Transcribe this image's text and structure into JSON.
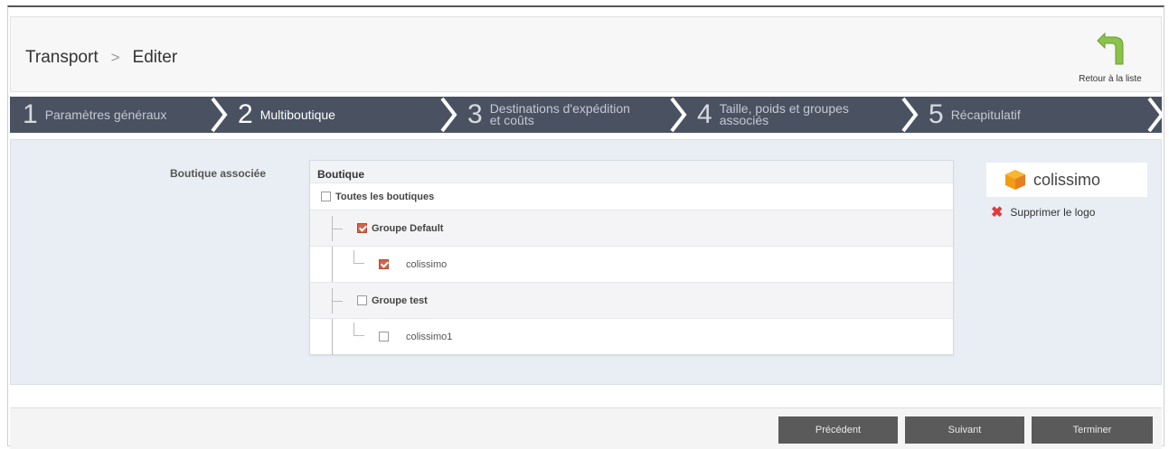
{
  "header": {
    "breadcrumb": [
      "Transport",
      "Editer"
    ],
    "separator": ">",
    "back_label": "Retour à la liste"
  },
  "steps": [
    {
      "num": "1",
      "label": "Paramètres généraux",
      "active": false
    },
    {
      "num": "2",
      "label": "Multiboutique",
      "active": true
    },
    {
      "num": "3",
      "label": "Destinations d'expédition et coûts",
      "active": false
    },
    {
      "num": "4",
      "label": "Taille, poids et groupes associés",
      "active": false
    },
    {
      "num": "5",
      "label": "Récapitulatif",
      "active": false
    }
  ],
  "form": {
    "shop_label": "Boutique associée",
    "tree_header": "Boutique",
    "all_shops": "Toutes les boutiques",
    "group_default": "Groupe Default",
    "shop_default": "colissimo",
    "group_test": "Groupe test",
    "shop_test": "colissimo1",
    "checked": {
      "all": false,
      "group_default": true,
      "shop_default": true,
      "group_test": false,
      "shop_test": false
    }
  },
  "logo": {
    "text": "colissimo",
    "delete_label": "Supprimer le logo",
    "brand_color": "#f39c12"
  },
  "footer": {
    "prev": "Précédent",
    "next": "Suivant",
    "finish": "Terminer"
  },
  "colors": {
    "steps_bg": "#4a5262",
    "panel_bg": "#e9edf4",
    "check_color": "#d0644a",
    "back_arrow": "#8bc34a"
  }
}
